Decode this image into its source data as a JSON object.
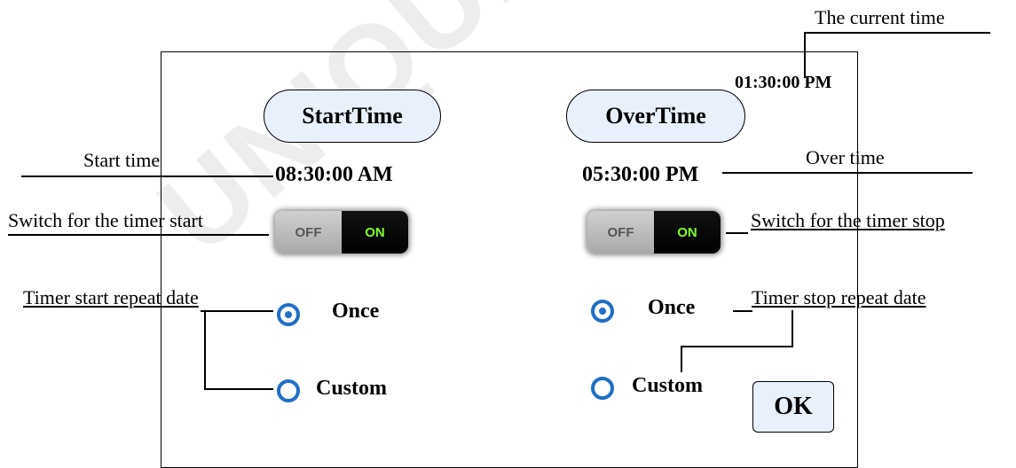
{
  "watermark": "UNIQUE DUT",
  "clock": {
    "current_time": "01:30:00 PM"
  },
  "start": {
    "tab_label": "StartTime",
    "time": "08:30:00 AM",
    "toggle": {
      "off_label": "OFF",
      "on_label": "ON",
      "state": "on"
    },
    "repeat_options": [
      {
        "label": "Once",
        "selected": true
      },
      {
        "label": "Custom",
        "selected": false
      }
    ]
  },
  "over": {
    "tab_label": "OverTime",
    "time": "05:30:00 PM",
    "toggle": {
      "off_label": "OFF",
      "on_label": "ON",
      "state": "on"
    },
    "repeat_options": [
      {
        "label": "Once",
        "selected": true
      },
      {
        "label": "Custom",
        "selected": false
      }
    ]
  },
  "ok_label": "OK",
  "annotations": {
    "current_time": "The current time",
    "start_time": "Start time",
    "over_time": "Over time",
    "switch_start": "Switch for the timer start",
    "switch_stop": "Switch for the timer stop",
    "repeat_start": "Timer start repeat date",
    "repeat_stop": "Timer stop repeat date"
  },
  "colors": {
    "accent": "#1f6fc6",
    "button_fill": "#e8f0fb",
    "toggle_on_text": "#7dff2a"
  }
}
